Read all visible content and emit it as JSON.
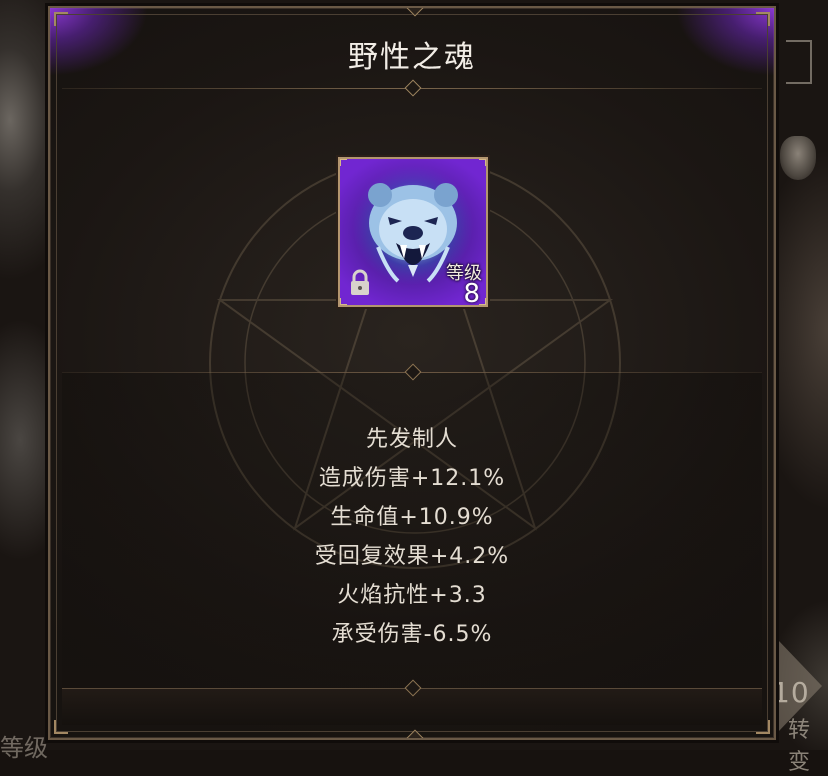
{
  "dialog": {
    "title": "野性之魂"
  },
  "item": {
    "icon": "bear-spirit-icon",
    "locked": true,
    "level_label": "等级",
    "level_value": "8"
  },
  "stats": [
    "先发制人",
    "造成伤害+12.1%",
    "生命值+10.9%",
    "受回复效果+4.2%",
    "火焰抗性+3.3",
    "承受伤害-6.5%"
  ],
  "background": {
    "right_number": "10",
    "right_bottom_text": "转变",
    "left_bottom_text": "等级"
  },
  "colors": {
    "frame_gold": "#b39670",
    "accent_purple": "#8a3ce0",
    "text_light": "#e4ddd2"
  }
}
